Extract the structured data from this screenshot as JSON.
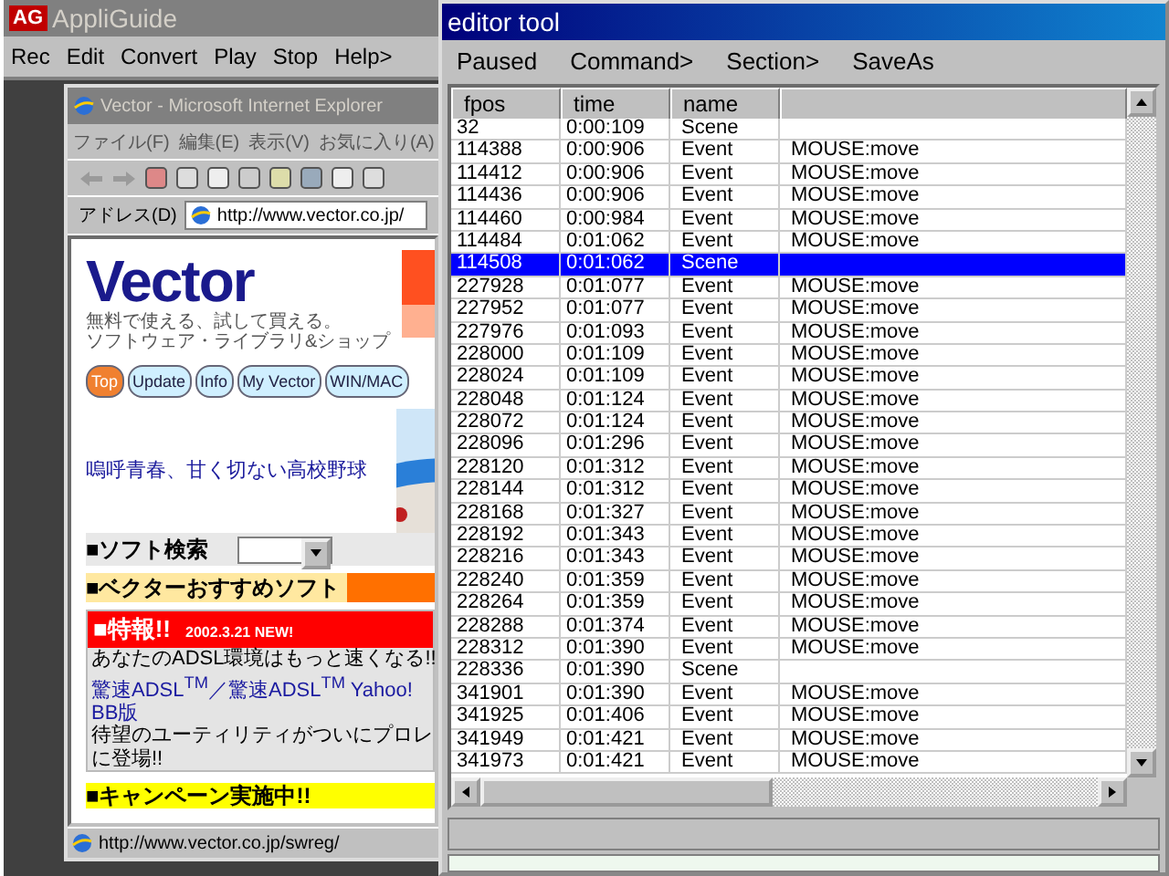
{
  "appliguide": {
    "logo": "AG",
    "title": "AppliGuide",
    "menu": [
      "Rec",
      "Edit",
      "Convert",
      "Play",
      "Stop",
      "Help>"
    ]
  },
  "browser": {
    "title": "Vector - Microsoft Internet Explorer",
    "menu": [
      "ファイル(F)",
      "編集(E)",
      "表示(V)",
      "お気に入り(A)"
    ],
    "address_label": "アドレス(D)",
    "address": "http://www.vector.co.jp/",
    "page": {
      "logo": "Vector",
      "tagline": [
        "無料で使える、試して買える。",
        "ソフトウェア・ライブラリ&ショップ"
      ],
      "nav": [
        {
          "label": "Top",
          "selected": true
        },
        {
          "label": "Update",
          "selected": false
        },
        {
          "label": "Info",
          "selected": false
        },
        {
          "label": "My Vector",
          "selected": false
        },
        {
          "label": "WIN/MAC",
          "selected": false
        }
      ],
      "banner": "嗚呼青春、甘く切ない高校野球",
      "search_label": "■ソフト検索",
      "recommend": "■ベクターおすすめソフト",
      "news_title": "■特報!!",
      "news_date": "2002.3.21 NEW!",
      "news_lines": [
        {
          "kind": "text",
          "text": "あなたのADSL環境はもっと速くなる!!"
        },
        {
          "kind": "link",
          "text": "驚速ADSL$^{TM}$／驚速ADSL$^{TM}$ Yahoo!"
        },
        {
          "kind": "link",
          "text": "BB版"
        },
        {
          "kind": "text",
          "text": "待望のユーティリティがついにプロレ"
        },
        {
          "kind": "text",
          "text": "に登場!!"
        }
      ],
      "campaign": "■キャンペーン実施中!!"
    },
    "status": "http://www.vector.co.jp/swreg/"
  },
  "editor": {
    "title": "editor tool",
    "menu": [
      "Paused",
      "Command>",
      "Section>",
      "SaveAs"
    ],
    "columns": [
      "fpos",
      "time",
      "name"
    ],
    "rows": [
      {
        "fpos": "32",
        "time": "0:00:109",
        "name": "Scene",
        "column_4": "",
        "selected": false
      },
      {
        "fpos": "114388",
        "time": "0:00:906",
        "name": "Event",
        "column_4": "MOUSE:move",
        "selected": false
      },
      {
        "fpos": "114412",
        "time": "0:00:906",
        "name": "Event",
        "column_4": "MOUSE:move",
        "selected": false
      },
      {
        "fpos": "114436",
        "time": "0:00:906",
        "name": "Event",
        "column_4": "MOUSE:move",
        "selected": false
      },
      {
        "fpos": "114460",
        "time": "0:00:984",
        "name": "Event",
        "column_4": "MOUSE:move",
        "selected": false
      },
      {
        "fpos": "114484",
        "time": "0:01:062",
        "name": "Event",
        "column_4": "MOUSE:move",
        "selected": false
      },
      {
        "fpos": "114508",
        "time": "0:01:062",
        "name": "Scene",
        "column_4": "",
        "selected": true
      },
      {
        "fpos": "227928",
        "time": "0:01:077",
        "name": "Event",
        "column_4": "MOUSE:move",
        "selected": false
      },
      {
        "fpos": "227952",
        "time": "0:01:077",
        "name": "Event",
        "column_4": "MOUSE:move",
        "selected": false
      },
      {
        "fpos": "227976",
        "time": "0:01:093",
        "name": "Event",
        "column_4": "MOUSE:move",
        "selected": false
      },
      {
        "fpos": "228000",
        "time": "0:01:109",
        "name": "Event",
        "column_4": "MOUSE:move",
        "selected": false
      },
      {
        "fpos": "228024",
        "time": "0:01:109",
        "name": "Event",
        "column_4": "MOUSE:move",
        "selected": false
      },
      {
        "fpos": "228048",
        "time": "0:01:124",
        "name": "Event",
        "column_4": "MOUSE:move",
        "selected": false
      },
      {
        "fpos": "228072",
        "time": "0:01:124",
        "name": "Event",
        "column_4": "MOUSE:move",
        "selected": false
      },
      {
        "fpos": "228096",
        "time": "0:01:296",
        "name": "Event",
        "column_4": "MOUSE:move",
        "selected": false
      },
      {
        "fpos": "228120",
        "time": "0:01:312",
        "name": "Event",
        "column_4": "MOUSE:move",
        "selected": false
      },
      {
        "fpos": "228144",
        "time": "0:01:312",
        "name": "Event",
        "column_4": "MOUSE:move",
        "selected": false
      },
      {
        "fpos": "228168",
        "time": "0:01:327",
        "name": "Event",
        "column_4": "MOUSE:move",
        "selected": false
      },
      {
        "fpos": "228192",
        "time": "0:01:343",
        "name": "Event",
        "column_4": "MOUSE:move",
        "selected": false
      },
      {
        "fpos": "228216",
        "time": "0:01:343",
        "name": "Event",
        "column_4": "MOUSE:move",
        "selected": false
      },
      {
        "fpos": "228240",
        "time": "0:01:359",
        "name": "Event",
        "column_4": "MOUSE:move",
        "selected": false
      },
      {
        "fpos": "228264",
        "time": "0:01:359",
        "name": "Event",
        "column_4": "MOUSE:move",
        "selected": false
      },
      {
        "fpos": "228288",
        "time": "0:01:374",
        "name": "Event",
        "column_4": "MOUSE:move",
        "selected": false
      },
      {
        "fpos": "228312",
        "time": "0:01:390",
        "name": "Event",
        "column_4": "MOUSE:move",
        "selected": false
      },
      {
        "fpos": "228336",
        "time": "0:01:390",
        "name": "Scene",
        "column_4": "",
        "selected": false
      },
      {
        "fpos": "341901",
        "time": "0:01:390",
        "name": "Event",
        "column_4": "MOUSE:move",
        "selected": false
      },
      {
        "fpos": "341925",
        "time": "0:01:406",
        "name": "Event",
        "column_4": "MOUSE:move",
        "selected": false
      },
      {
        "fpos": "341949",
        "time": "0:01:421",
        "name": "Event",
        "column_4": "MOUSE:move",
        "selected": false
      },
      {
        "fpos": "341973",
        "time": "0:01:421",
        "name": "Event",
        "column_4": "MOUSE:move",
        "selected": false
      }
    ]
  }
}
